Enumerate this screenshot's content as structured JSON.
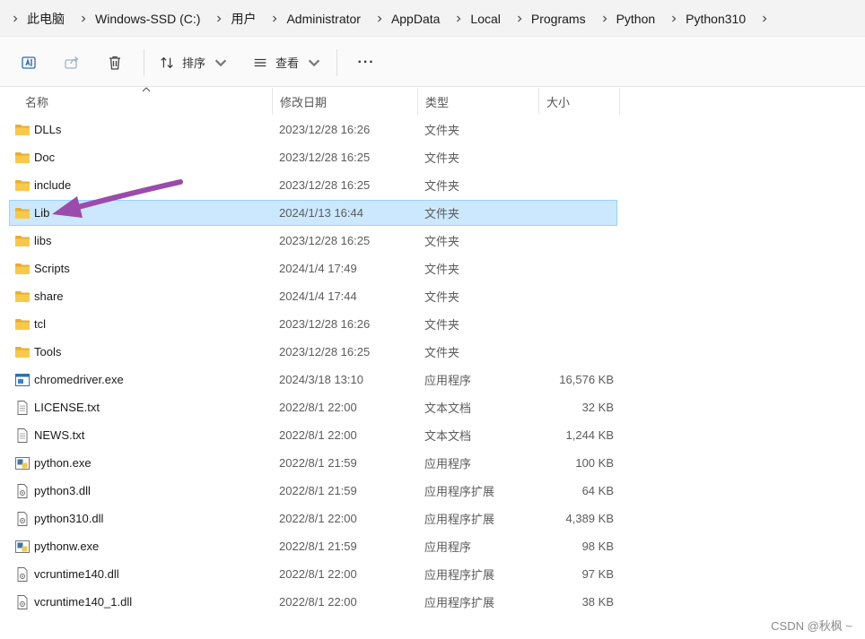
{
  "breadcrumb": {
    "items": [
      "此电脑",
      "Windows-SSD (C:)",
      "用户",
      "Administrator",
      "AppData",
      "Local",
      "Programs",
      "Python",
      "Python310"
    ]
  },
  "toolbar": {
    "sort_label": "排序",
    "view_label": "查看",
    "more_label": "···"
  },
  "columns": {
    "name": "名称",
    "modified": "修改日期",
    "type": "类型",
    "size": "大小"
  },
  "files": [
    {
      "name": "DLLs",
      "modified": "2023/12/28 16:26",
      "type": "文件夹",
      "size": "",
      "icon": "folder-icon"
    },
    {
      "name": "Doc",
      "modified": "2023/12/28 16:25",
      "type": "文件夹",
      "size": "",
      "icon": "folder-icon"
    },
    {
      "name": "include",
      "modified": "2023/12/28 16:25",
      "type": "文件夹",
      "size": "",
      "icon": "folder-icon"
    },
    {
      "name": "Lib",
      "modified": "2024/1/13 16:44",
      "type": "文件夹",
      "size": "",
      "icon": "folder-icon",
      "selected": true
    },
    {
      "name": "libs",
      "modified": "2023/12/28 16:25",
      "type": "文件夹",
      "size": "",
      "icon": "folder-icon"
    },
    {
      "name": "Scripts",
      "modified": "2024/1/4 17:49",
      "type": "文件夹",
      "size": "",
      "icon": "folder-icon"
    },
    {
      "name": "share",
      "modified": "2024/1/4 17:44",
      "type": "文件夹",
      "size": "",
      "icon": "folder-icon"
    },
    {
      "name": "tcl",
      "modified": "2023/12/28 16:26",
      "type": "文件夹",
      "size": "",
      "icon": "folder-icon"
    },
    {
      "name": "Tools",
      "modified": "2023/12/28 16:25",
      "type": "文件夹",
      "size": "",
      "icon": "folder-icon"
    },
    {
      "name": "chromedriver.exe",
      "modified": "2024/3/18 13:10",
      "type": "应用程序",
      "size": "16,576 KB",
      "icon": "app-window-icon"
    },
    {
      "name": "LICENSE.txt",
      "modified": "2022/8/1 22:00",
      "type": "文本文档",
      "size": "32 KB",
      "icon": "text-file-icon"
    },
    {
      "name": "NEWS.txt",
      "modified": "2022/8/1 22:00",
      "type": "文本文档",
      "size": "1,244 KB",
      "icon": "text-file-icon"
    },
    {
      "name": "python.exe",
      "modified": "2022/8/1 21:59",
      "type": "应用程序",
      "size": "100 KB",
      "icon": "python-exe-icon"
    },
    {
      "name": "python3.dll",
      "modified": "2022/8/1 21:59",
      "type": "应用程序扩展",
      "size": "64 KB",
      "icon": "dll-file-icon"
    },
    {
      "name": "python310.dll",
      "modified": "2022/8/1 22:00",
      "type": "应用程序扩展",
      "size": "4,389 KB",
      "icon": "dll-file-icon"
    },
    {
      "name": "pythonw.exe",
      "modified": "2022/8/1 21:59",
      "type": "应用程序",
      "size": "98 KB",
      "icon": "python-exe-icon"
    },
    {
      "name": "vcruntime140.dll",
      "modified": "2022/8/1 22:00",
      "type": "应用程序扩展",
      "size": "97 KB",
      "icon": "dll-file-icon"
    },
    {
      "name": "vcruntime140_1.dll",
      "modified": "2022/8/1 22:00",
      "type": "应用程序扩展",
      "size": "38 KB",
      "icon": "dll-file-icon"
    }
  ],
  "watermark": "CSDN @秋枫 ~",
  "colors": {
    "selection_bg": "#cce8ff",
    "selection_border": "#99d1ff",
    "folder": "#f8c94a",
    "arrow": "#9b4bab"
  }
}
